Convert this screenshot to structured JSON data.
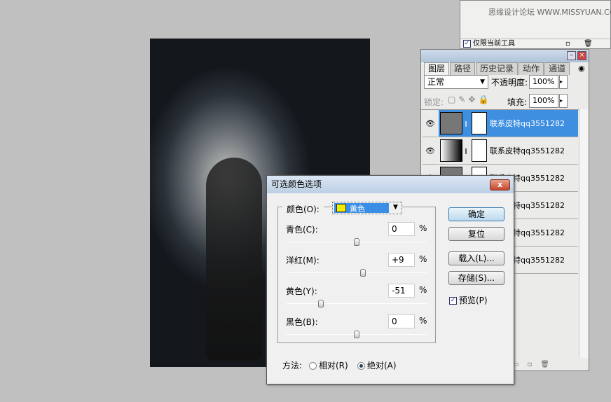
{
  "top_panel": {
    "watermark": "思缘设计论坛 WWW.MISSYUAN.COM",
    "checkbox_label": "仅限当前工具",
    "checked": true
  },
  "layers_panel": {
    "tabs": [
      "图层",
      "路径",
      "历史记录",
      "动作",
      "通道"
    ],
    "active_tab": "图层",
    "blend_mode": "正常",
    "opacity_label": "不透明度:",
    "opacity": "100%",
    "lock_label": "锁定:",
    "fill_label": "填充:",
    "fill": "100%",
    "layers": [
      {
        "name": "联系皮特qq3551282",
        "selected": true
      },
      {
        "name": "联系皮特qq3551282"
      },
      {
        "name": "联系皮特qq3551282"
      },
      {
        "name": "联系皮特qq3551282"
      },
      {
        "name": "联系皮特qq3551282"
      },
      {
        "name": "联系皮特qq3551282"
      }
    ]
  },
  "dialog": {
    "title": "可选颜色选项",
    "close": "x",
    "colors_label": "颜色(O):",
    "colors_value": "黄色",
    "swatch_color": "#f2ee00",
    "sliders": [
      {
        "label": "青色(C):",
        "value": "0",
        "unit": "%",
        "level": 0
      },
      {
        "label": "洋红(M):",
        "value": "+9",
        "unit": "%",
        "level": 9
      },
      {
        "label": "黄色(Y):",
        "value": "-51",
        "unit": "%",
        "level": -51
      },
      {
        "label": "黑色(B):",
        "value": "0",
        "unit": "%",
        "level": 0
      }
    ],
    "buttons": {
      "ok": "确定",
      "reset": "复位",
      "load": "载入(L)...",
      "save": "存储(S)..."
    },
    "preview_label": "预览(P)",
    "preview_checked": true,
    "method_label": "方法:",
    "relative": "相对(R)",
    "absolute": "绝对(A)",
    "method": "absolute"
  }
}
